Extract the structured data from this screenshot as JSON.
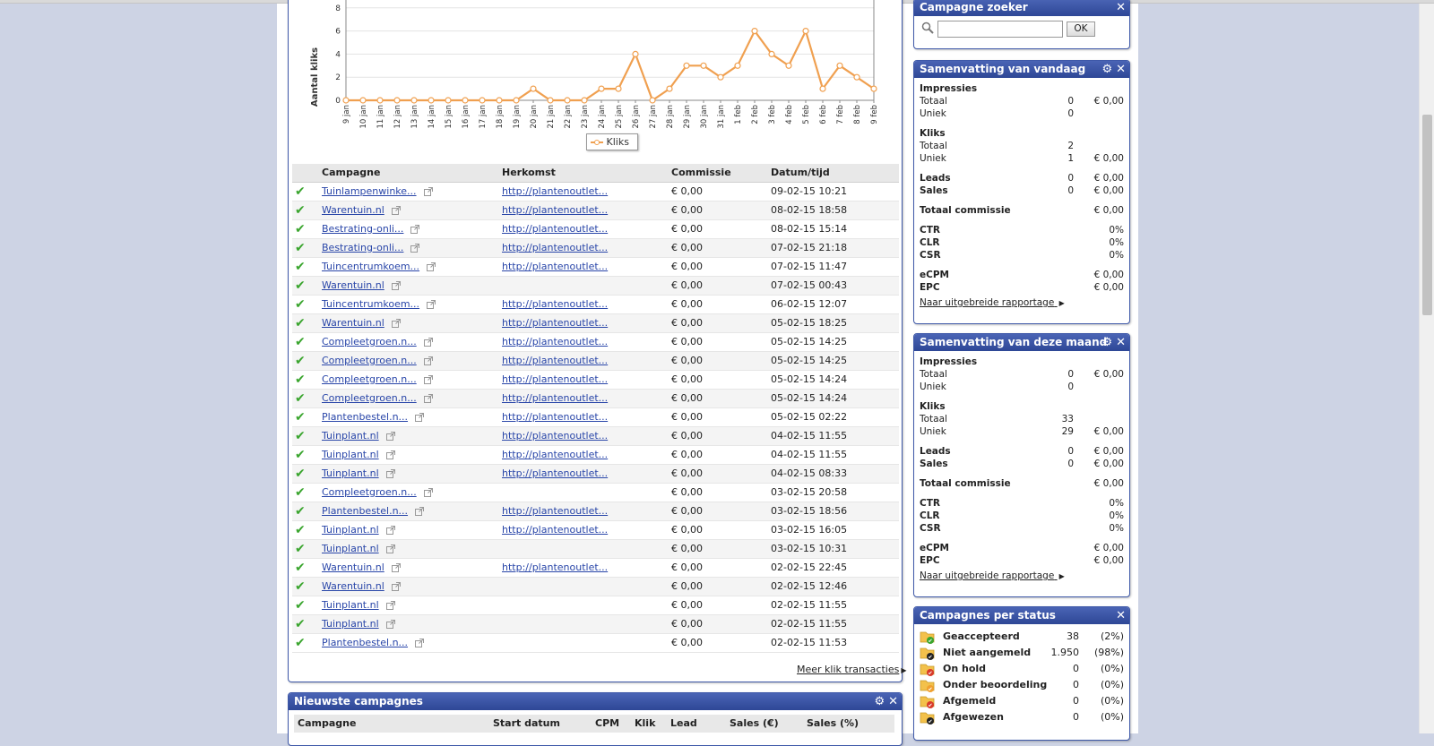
{
  "chart_data": {
    "type": "line",
    "ylabel": "Aantal kliks",
    "yticks": [
      "0",
      "2",
      "4",
      "6",
      "8"
    ],
    "ylim": [
      0,
      10
    ],
    "legend": "Kliks",
    "series": [
      {
        "name": "Kliks",
        "color": "#f0a050"
      }
    ],
    "categories": [
      "9 jan",
      "10 jan",
      "11 jan",
      "12 jan",
      "13 jan",
      "14 jan",
      "15 jan",
      "16 jan",
      "17 jan",
      "18 jan",
      "19 jan",
      "20 jan",
      "21 jan",
      "22 jan",
      "23 jan",
      "24 jan",
      "25 jan",
      "26 jan",
      "27 jan",
      "28 jan",
      "29 jan",
      "30 jan",
      "31 jan",
      "1 feb",
      "2 feb",
      "3 feb",
      "4 feb",
      "5 feb",
      "6 feb",
      "7 feb",
      "8 feb",
      "9 feb"
    ],
    "values": [
      0,
      0,
      0,
      0,
      0,
      0,
      0,
      0,
      0,
      0,
      0,
      1,
      0,
      0,
      0,
      1,
      1,
      4,
      0,
      1,
      3,
      3,
      2,
      3,
      6,
      4,
      3,
      6,
      1,
      3,
      2,
      1
    ],
    "grid": true
  },
  "table": {
    "headers": [
      "Campagne",
      "Herkomst",
      "Commissie",
      "Datum/tijd"
    ],
    "rows": [
      {
        "campaign": "Tuinlampenwinke...",
        "origin": "http://plantenoutlet...",
        "commission": "€ 0,00",
        "datetime": "09-02-15 10:21"
      },
      {
        "campaign": "Warentuin.nl",
        "origin": "http://plantenoutlet...",
        "commission": "€ 0,00",
        "datetime": "08-02-15 18:58"
      },
      {
        "campaign": "Bestrating-onli...",
        "origin": "http://plantenoutlet...",
        "commission": "€ 0,00",
        "datetime": "08-02-15 15:14"
      },
      {
        "campaign": "Bestrating-onli...",
        "origin": "http://plantenoutlet...",
        "commission": "€ 0,00",
        "datetime": "07-02-15 21:18"
      },
      {
        "campaign": "Tuincentrumkoem...",
        "origin": "http://plantenoutlet...",
        "commission": "€ 0,00",
        "datetime": "07-02-15 11:47"
      },
      {
        "campaign": "Warentuin.nl",
        "origin": "",
        "commission": "€ 0,00",
        "datetime": "07-02-15 00:43"
      },
      {
        "campaign": "Tuincentrumkoem...",
        "origin": "http://plantenoutlet...",
        "commission": "€ 0,00",
        "datetime": "06-02-15 12:07"
      },
      {
        "campaign": "Warentuin.nl",
        "origin": "http://plantenoutlet...",
        "commission": "€ 0,00",
        "datetime": "05-02-15 18:25"
      },
      {
        "campaign": "Compleetgroen.n...",
        "origin": "http://plantenoutlet...",
        "commission": "€ 0,00",
        "datetime": "05-02-15 14:25"
      },
      {
        "campaign": "Compleetgroen.n...",
        "origin": "http://plantenoutlet...",
        "commission": "€ 0,00",
        "datetime": "05-02-15 14:25"
      },
      {
        "campaign": "Compleetgroen.n...",
        "origin": "http://plantenoutlet...",
        "commission": "€ 0,00",
        "datetime": "05-02-15 14:24"
      },
      {
        "campaign": "Compleetgroen.n...",
        "origin": "http://plantenoutlet...",
        "commission": "€ 0,00",
        "datetime": "05-02-15 14:24"
      },
      {
        "campaign": "Plantenbestel.n...",
        "origin": "http://plantenoutlet...",
        "commission": "€ 0,00",
        "datetime": "05-02-15 02:22"
      },
      {
        "campaign": "Tuinplant.nl",
        "origin": "http://plantenoutlet...",
        "commission": "€ 0,00",
        "datetime": "04-02-15 11:55"
      },
      {
        "campaign": "Tuinplant.nl",
        "origin": "http://plantenoutlet...",
        "commission": "€ 0,00",
        "datetime": "04-02-15 11:55"
      },
      {
        "campaign": "Tuinplant.nl",
        "origin": "http://plantenoutlet...",
        "commission": "€ 0,00",
        "datetime": "04-02-15 08:33"
      },
      {
        "campaign": "Compleetgroen.n...",
        "origin": "",
        "commission": "€ 0,00",
        "datetime": "03-02-15 20:58"
      },
      {
        "campaign": "Plantenbestel.n...",
        "origin": "http://plantenoutlet...",
        "commission": "€ 0,00",
        "datetime": "03-02-15 18:56"
      },
      {
        "campaign": "Tuinplant.nl",
        "origin": "http://plantenoutlet...",
        "commission": "€ 0,00",
        "datetime": "03-02-15 16:05"
      },
      {
        "campaign": "Tuinplant.nl",
        "origin": "",
        "commission": "€ 0,00",
        "datetime": "03-02-15 10:31"
      },
      {
        "campaign": "Warentuin.nl",
        "origin": "http://plantenoutlet...",
        "commission": "€ 0,00",
        "datetime": "02-02-15 22:45"
      },
      {
        "campaign": "Warentuin.nl",
        "origin": "",
        "commission": "€ 0,00",
        "datetime": "02-02-15 12:46"
      },
      {
        "campaign": "Tuinplant.nl",
        "origin": "",
        "commission": "€ 0,00",
        "datetime": "02-02-15 11:55"
      },
      {
        "campaign": "Tuinplant.nl",
        "origin": "",
        "commission": "€ 0,00",
        "datetime": "02-02-15 11:55"
      },
      {
        "campaign": "Plantenbestel.n...",
        "origin": "",
        "commission": "€ 0,00",
        "datetime": "02-02-15 11:53"
      }
    ],
    "more_link": "Meer klik transacties"
  },
  "newest": {
    "title": "Nieuwste campagnes",
    "headers": [
      "Campagne",
      "Start datum",
      "CPM",
      "Klik",
      "Lead",
      "Sales (€)",
      "Sales (%)"
    ]
  },
  "search": {
    "title": "Campagne zoeker",
    "value": "",
    "ok": "OK"
  },
  "today": {
    "title": "Samenvatting van vandaag",
    "impressions": "Impressies",
    "imp_total_label": "Totaal",
    "imp_total": "0",
    "imp_total_amt": "€ 0,00",
    "imp_unique_label": "Uniek",
    "imp_unique": "0",
    "clicks": "Kliks",
    "clk_total_label": "Totaal",
    "clk_total": "2",
    "clk_unique_label": "Uniek",
    "clk_unique": "1",
    "clk_unique_amt": "€ 0,00",
    "leads_label": "Leads",
    "leads": "0",
    "leads_amt": "€ 0,00",
    "sales_label": "Sales",
    "sales": "0",
    "sales_amt": "€ 0,00",
    "total_comm_label": "Totaal commissie",
    "total_comm": "€ 0,00",
    "ctr_label": "CTR",
    "ctr": "0%",
    "clr_label": "CLR",
    "clr": "0%",
    "csr_label": "CSR",
    "csr": "0%",
    "ecpm_label": "eCPM",
    "ecpm": "€ 0,00",
    "epc_label": "EPC",
    "epc": "€ 0,00",
    "report_link": "Naar uitgebreide rapportage"
  },
  "month": {
    "title": "Samenvatting van deze maand",
    "impressions": "Impressies",
    "imp_total_label": "Totaal",
    "imp_total": "0",
    "imp_total_amt": "€ 0,00",
    "imp_unique_label": "Uniek",
    "imp_unique": "0",
    "clicks": "Kliks",
    "clk_total_label": "Totaal",
    "clk_total": "33",
    "clk_unique_label": "Uniek",
    "clk_unique": "29",
    "clk_unique_amt": "€ 0,00",
    "leads_label": "Leads",
    "leads": "0",
    "leads_amt": "€ 0,00",
    "sales_label": "Sales",
    "sales": "0",
    "sales_amt": "€ 0,00",
    "total_comm_label": "Totaal commissie",
    "total_comm": "€ 0,00",
    "ctr_label": "CTR",
    "ctr": "0%",
    "clr_label": "CLR",
    "clr": "0%",
    "csr_label": "CSR",
    "csr": "0%",
    "ecpm_label": "eCPM",
    "ecpm": "€ 0,00",
    "epc_label": "EPC",
    "epc": "€ 0,00",
    "report_link": "Naar uitgebreide rapportage"
  },
  "status": {
    "title": "Campagnes per status",
    "items": [
      {
        "label": "Geaccepteerd",
        "count": "38",
        "pct": "(2%)",
        "icon": "accepted-icon",
        "color": "#3aa52e"
      },
      {
        "label": "Niet aangemeld",
        "count": "1.950",
        "pct": "(98%)",
        "icon": "not-registered-icon",
        "color": "#222222"
      },
      {
        "label": "On hold",
        "count": "0",
        "pct": "(0%)",
        "icon": "on-hold-icon",
        "color": "#d83a2a"
      },
      {
        "label": "Onder beoordeling",
        "count": "0",
        "pct": "(0%)",
        "icon": "under-review-icon",
        "color": "#f0a030"
      },
      {
        "label": "Afgemeld",
        "count": "0",
        "pct": "(0%)",
        "icon": "unsubscribed-icon",
        "color": "#d83a2a"
      },
      {
        "label": "Afgewezen",
        "count": "0",
        "pct": "(0%)",
        "icon": "rejected-icon",
        "color": "#222222"
      }
    ]
  }
}
